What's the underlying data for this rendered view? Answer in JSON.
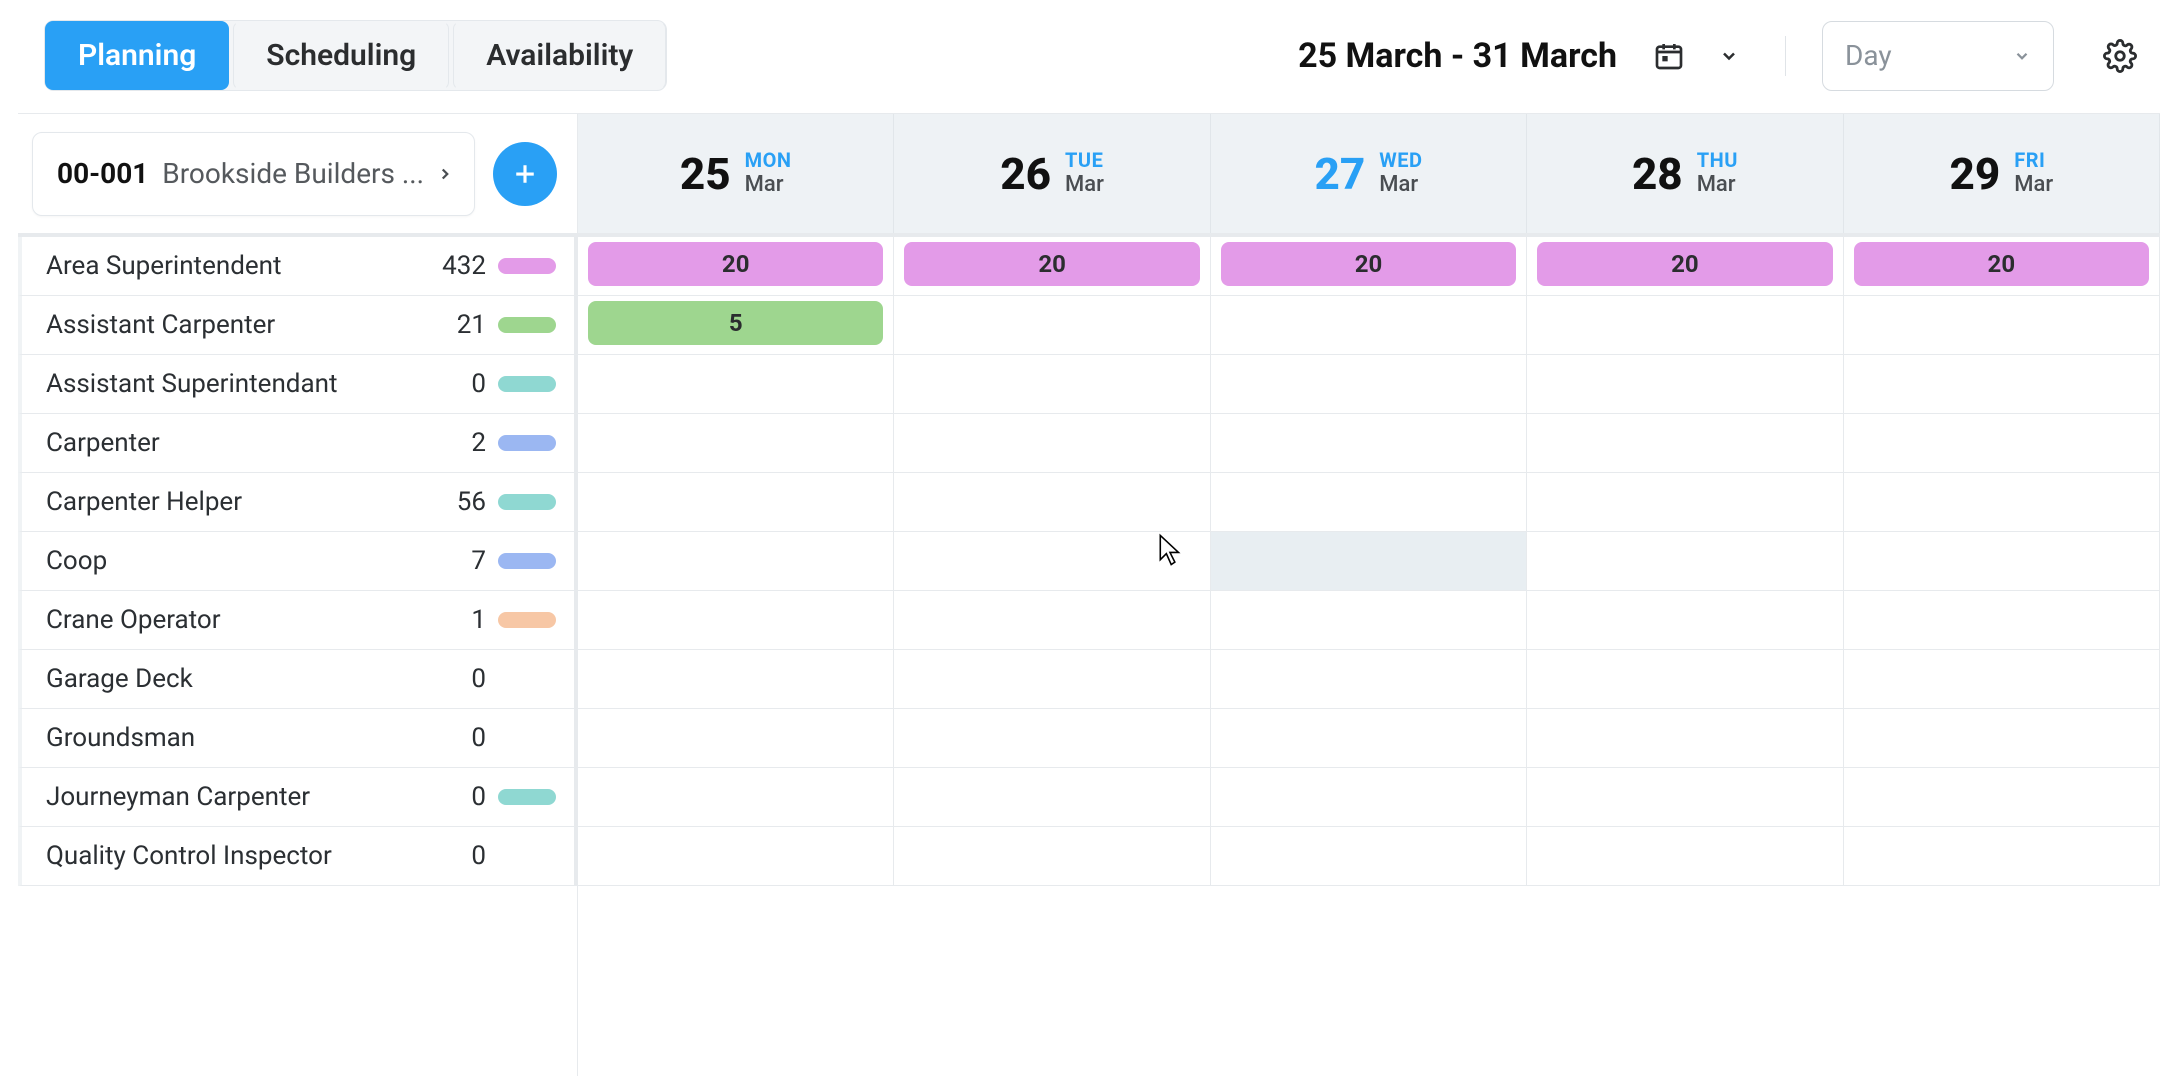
{
  "topbar": {
    "tabs": [
      "Planning",
      "Scheduling",
      "Availability"
    ],
    "active_tab_index": 0,
    "date_range_label": "25 March - 31 March",
    "period_label": "Day"
  },
  "project": {
    "code": "00-001",
    "name": "Brookside Builders ..."
  },
  "days": [
    {
      "num": "25",
      "dow": "MON",
      "month": "Mar",
      "today": false
    },
    {
      "num": "26",
      "dow": "TUE",
      "month": "Mar",
      "today": false
    },
    {
      "num": "27",
      "dow": "WED",
      "month": "Mar",
      "today": true
    },
    {
      "num": "28",
      "dow": "THU",
      "month": "Mar",
      "today": false
    },
    {
      "num": "29",
      "dow": "FRI",
      "month": "Mar",
      "today": false
    }
  ],
  "roles": [
    {
      "name": "Area Superintendent",
      "count": "432",
      "color": "#e39be8",
      "blocks": [
        "20",
        "20",
        "20",
        "20",
        "20"
      ]
    },
    {
      "name": "Assistant Carpenter",
      "count": "21",
      "color": "#9ed68f",
      "blocks": [
        "5",
        "",
        "",
        "",
        ""
      ]
    },
    {
      "name": "Assistant Superintendant",
      "count": "0",
      "color": "#8fd8d2",
      "blocks": [
        "",
        "",
        "",
        "",
        ""
      ]
    },
    {
      "name": "Carpenter",
      "count": "2",
      "color": "#9bb7f2",
      "blocks": [
        "",
        "",
        "",
        "",
        ""
      ]
    },
    {
      "name": "Carpenter Helper",
      "count": "56",
      "color": "#8fd8d2",
      "blocks": [
        "",
        "",
        "",
        "",
        ""
      ]
    },
    {
      "name": "Coop",
      "count": "7",
      "color": "#9bb7f2",
      "blocks": [
        "",
        "",
        "",
        "",
        ""
      ],
      "hover_day_index": 2
    },
    {
      "name": "Crane Operator",
      "count": "1",
      "color": "#f7c7a5",
      "blocks": [
        "",
        "",
        "",
        "",
        ""
      ]
    },
    {
      "name": "Garage Deck",
      "count": "0",
      "color": "",
      "blocks": [
        "",
        "",
        "",
        "",
        ""
      ]
    },
    {
      "name": "Groundsman",
      "count": "0",
      "color": "",
      "blocks": [
        "",
        "",
        "",
        "",
        ""
      ]
    },
    {
      "name": "Journeyman Carpenter",
      "count": "0",
      "color": "#8fd8d2",
      "blocks": [
        "",
        "",
        "",
        "",
        ""
      ]
    },
    {
      "name": "Quality Control Inspector",
      "count": "0",
      "color": "",
      "blocks": [
        "",
        "",
        "",
        "",
        ""
      ]
    }
  ]
}
